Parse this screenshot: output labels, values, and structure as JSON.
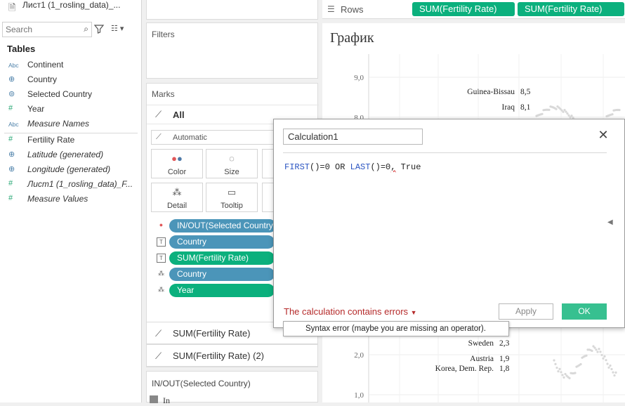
{
  "datasource": {
    "label": "Лист1 (1_rosling_data)_..."
  },
  "search": {
    "placeholder": "Search"
  },
  "tables_heading": "Tables",
  "fields": [
    {
      "type": "Abc",
      "name": "Continent",
      "italic": false
    },
    {
      "type": "geo",
      "name": "Country",
      "italic": false
    },
    {
      "type": "set",
      "name": "Selected Country",
      "italic": false
    },
    {
      "type": "#",
      "name": "Year",
      "italic": false
    },
    {
      "type": "Abc",
      "name": "Measure Names",
      "italic": true
    },
    {
      "type": "#",
      "name": "Fertility Rate",
      "italic": false
    },
    {
      "type": "geo",
      "name": "Latitude (generated)",
      "italic": true
    },
    {
      "type": "geo",
      "name": "Longitude (generated)",
      "italic": true
    },
    {
      "type": "#",
      "name": "Лист1 (1_rosling_data)_F...",
      "italic": true
    },
    {
      "type": "#",
      "name": "Measure Values",
      "italic": true
    }
  ],
  "filters": {
    "title": "Filters"
  },
  "marks": {
    "title": "Marks",
    "all_label": "All",
    "mark_type": "Automatic",
    "buttons": [
      {
        "name": "color",
        "label": "Color",
        "icon": "●●"
      },
      {
        "name": "size",
        "label": "Size",
        "icon": "◌"
      },
      {
        "name": "detail",
        "label": "Detail",
        "icon": "⁂"
      },
      {
        "name": "tooltip",
        "label": "Tooltip",
        "icon": "▭"
      }
    ],
    "pills": [
      {
        "icon": "color",
        "label": "IN/OUT(Selected Country)",
        "color": "blue"
      },
      {
        "icon": "text",
        "label": "Country",
        "color": "blue"
      },
      {
        "icon": "text",
        "label": "SUM(Fertility Rate)",
        "color": "green"
      },
      {
        "icon": "detail",
        "label": "Country",
        "color": "blue"
      },
      {
        "icon": "detail",
        "label": "Year",
        "color": "green"
      }
    ],
    "sum1": "SUM(Fertility Rate)",
    "sum2": "SUM(Fertility Rate) (2)"
  },
  "legend": {
    "title": "IN/OUT(Selected Country)",
    "item": "In"
  },
  "rows": {
    "label": "Rows",
    "pills": [
      "SUM(Fertility Rate)",
      "SUM(Fertility Rate)"
    ]
  },
  "viz": {
    "title": "График"
  },
  "chart_data": {
    "type": "scatter",
    "title": "График",
    "y_ticks": [
      "9,0",
      "8,0",
      "2,0",
      "1,0"
    ],
    "labels": [
      {
        "country": "Guinea-Bissau",
        "value": "8,5"
      },
      {
        "country": "Iraq",
        "value": "8,1"
      },
      {
        "country": "Sweden",
        "value": "2,3"
      },
      {
        "country": "Austria",
        "value": "1,9"
      },
      {
        "country": "Korea, Dem. Rep.",
        "value": "1,8"
      }
    ]
  },
  "dialog": {
    "calc_name": "Calculation1",
    "formula_parts": [
      {
        "text": "FIRST",
        "cls": "kw"
      },
      {
        "text": "()=0 OR ",
        "cls": ""
      },
      {
        "text": "LAST",
        "cls": "kw"
      },
      {
        "text": "()=0",
        "cls": ""
      },
      {
        "text": ",",
        "cls": "err"
      },
      {
        "text": " True",
        "cls": ""
      }
    ],
    "error_text": "The calculation contains errors",
    "apply_label": "Apply",
    "ok_label": "OK",
    "tooltip": "Syntax error (maybe you are missing an operator)."
  }
}
